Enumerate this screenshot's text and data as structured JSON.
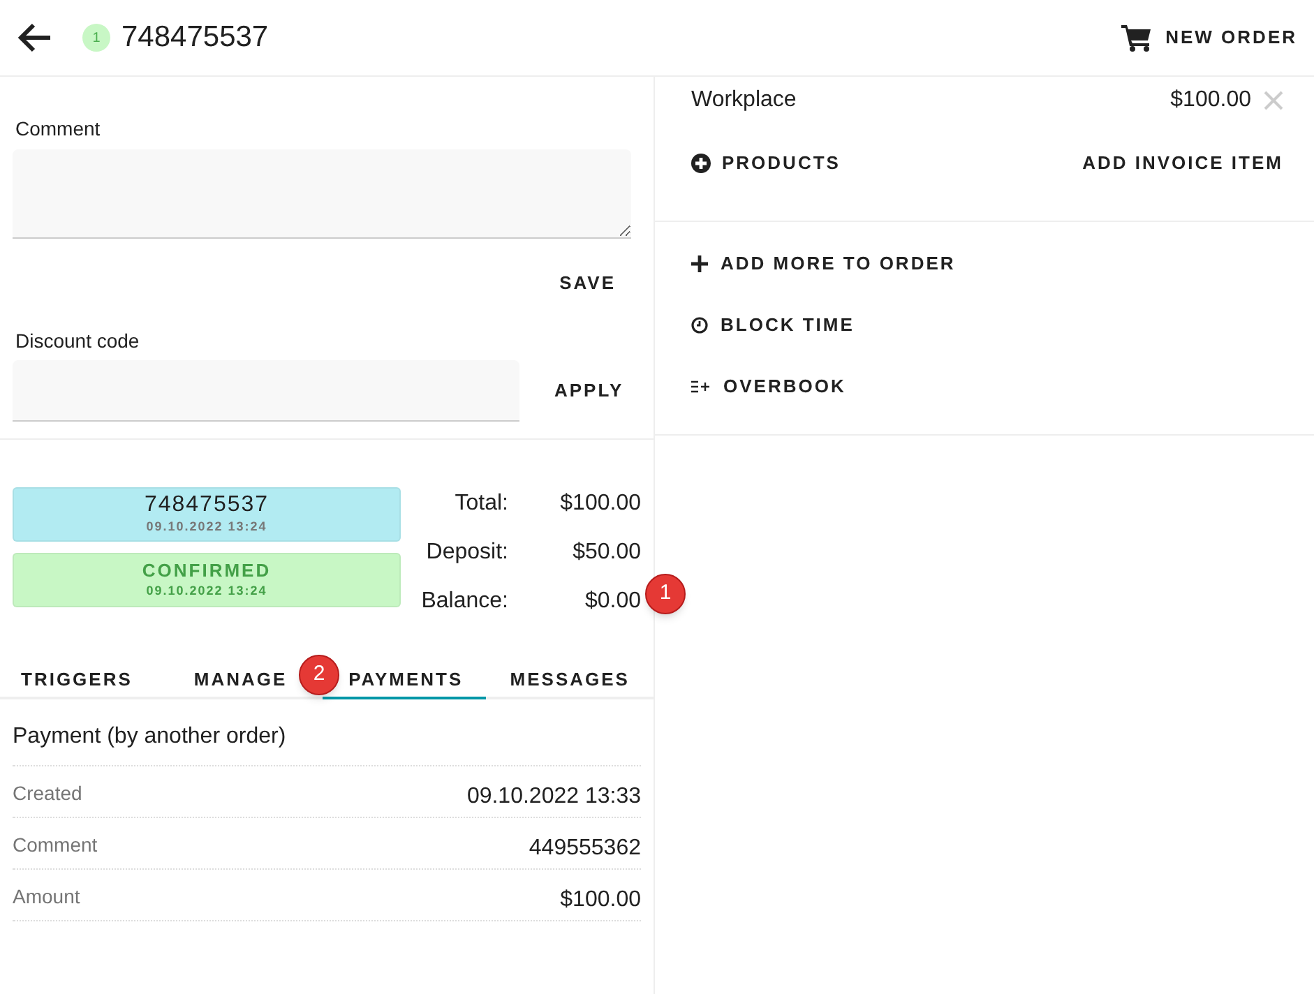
{
  "header": {
    "status_count": "1",
    "title": "748475537",
    "new_order": "NEW ORDER"
  },
  "comment": {
    "label": "Comment",
    "save": "SAVE"
  },
  "discount": {
    "label": "Discount code",
    "apply": "APPLY"
  },
  "status_cards": [
    {
      "kind": "order",
      "title": "748475537",
      "date": "09.10.2022 13:24"
    },
    {
      "kind": "confirmed",
      "title": "CONFIRMED",
      "date": "09.10.2022 13:24"
    }
  ],
  "totals": [
    {
      "label": "Total:",
      "value": "$100.00"
    },
    {
      "label": "Deposit:",
      "value": "$50.00"
    },
    {
      "label": "Balance:",
      "value": "$0.00"
    }
  ],
  "tabs": [
    {
      "label": "TRIGGERS",
      "selected": false
    },
    {
      "label": "MANAGE",
      "selected": false
    },
    {
      "label": "PAYMENTS",
      "selected": true
    },
    {
      "label": "MESSAGES",
      "selected": false
    }
  ],
  "payment": {
    "title": "Payment (by another order)",
    "rows": [
      {
        "label": "Created",
        "value": "09.10.2022 13:33"
      },
      {
        "label": "Comment",
        "value": "449555362"
      },
      {
        "label": "Amount",
        "value": "$100.00"
      }
    ]
  },
  "invoice": {
    "item": "Workplace",
    "price": "$100.00",
    "products": "PRODUCTS",
    "add_item": "ADD INVOICE ITEM"
  },
  "actions": [
    {
      "kind": "plus",
      "label": "ADD MORE TO ORDER"
    },
    {
      "kind": "clock",
      "label": "BLOCK TIME"
    },
    {
      "kind": "overbook",
      "label": "OVERBOOK"
    }
  ],
  "markers": [
    "1",
    "2"
  ]
}
